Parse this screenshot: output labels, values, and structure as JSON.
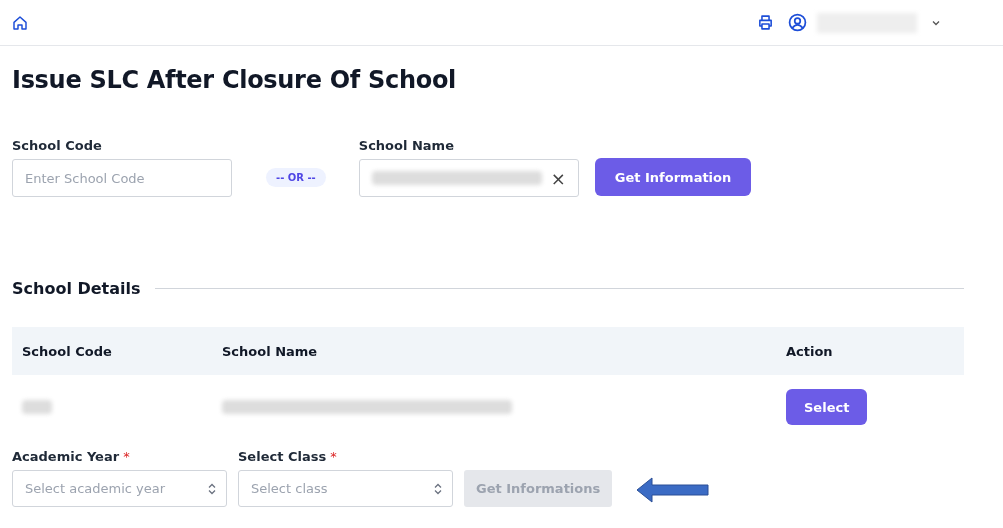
{
  "title": "Issue SLC After Closure Of School",
  "search": {
    "code_label": "School Code",
    "code_placeholder": "Enter School Code",
    "or_text": "-- OR --",
    "name_label": "School Name",
    "clear": "×",
    "button": "Get Information"
  },
  "details": {
    "heading": "School Details",
    "columns": [
      "School Code",
      "School Name",
      "Action"
    ],
    "rows": [
      {
        "action": "Select"
      }
    ]
  },
  "filters": [
    {
      "label": "Academic Year",
      "required_mark": "*",
      "placeholder": "Select academic year"
    },
    {
      "label": "Select Class",
      "required_mark": "*",
      "placeholder": "Select class"
    }
  ],
  "filter_button": {
    "label": "Get Informations",
    "disabled": true
  }
}
